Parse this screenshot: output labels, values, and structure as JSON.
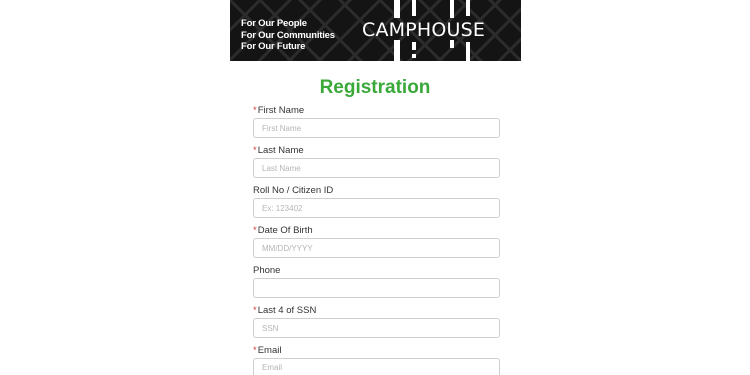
{
  "banner": {
    "tagline": [
      "For Our People",
      "For Our Communities",
      "For Our Future"
    ],
    "logo_text": "CAMPHOUSE",
    "background_color": "#141414"
  },
  "form": {
    "title": "Registration",
    "title_color": "#3aa93a",
    "required_marker": "*",
    "fields": [
      {
        "label": "First Name",
        "required": true,
        "placeholder": "First Name",
        "value": ""
      },
      {
        "label": "Last Name",
        "required": true,
        "placeholder": "Last Name",
        "value": ""
      },
      {
        "label": "Roll No / Citizen ID",
        "required": false,
        "placeholder": "Ex: 123402",
        "value": ""
      },
      {
        "label": "Date Of Birth",
        "required": true,
        "placeholder": "MM/DD/YYYY",
        "value": ""
      },
      {
        "label": "Phone",
        "required": false,
        "placeholder": "",
        "value": ""
      },
      {
        "label": "Last 4 of SSN",
        "required": true,
        "placeholder": "SSN",
        "value": ""
      },
      {
        "label": "Email",
        "required": true,
        "placeholder": "Email",
        "value": ""
      }
    ]
  }
}
